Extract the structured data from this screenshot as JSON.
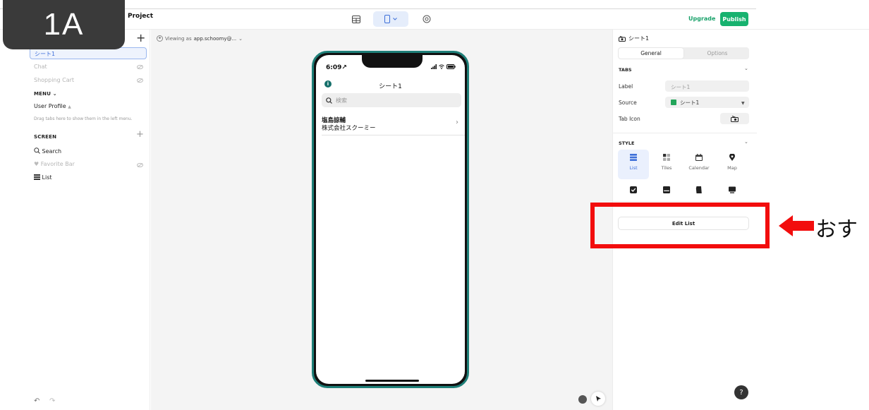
{
  "badge": {
    "label": "1A"
  },
  "header": {
    "project_title": "Project",
    "upgrade_label": "Upgrade",
    "publish_label": "Publish"
  },
  "sidebar": {
    "tabs": [
      {
        "label": "シート1",
        "active": true
      },
      {
        "label": "Chat",
        "hidden": true
      },
      {
        "label": "Shopping Cart",
        "hidden": true
      }
    ],
    "menu_section": "MENU",
    "menu_items": [
      {
        "label": "User Profile"
      }
    ],
    "menu_hint": "Drag tabs here to show them in the left menu.",
    "screen_section": "SCREEN",
    "screen_items": [
      {
        "label": "Search",
        "icon": "search-icon"
      },
      {
        "label": "Favorite Bar",
        "icon": "heart-icon",
        "hidden": true
      },
      {
        "label": "List",
        "icon": "list-icon"
      }
    ]
  },
  "canvas": {
    "viewing_prefix": "Viewing as",
    "viewing_user": "app.schoomy@...",
    "phone": {
      "time": "6:09",
      "title": "シート1",
      "search_placeholder": "検索",
      "rows": [
        {
          "title": "塩島諒輔",
          "subtitle": "株式会社スクーミー"
        }
      ]
    }
  },
  "panel": {
    "title": "シート1",
    "segments": {
      "general": "General",
      "options": "Options"
    },
    "tabs_section": "TABS",
    "label_label": "Label",
    "label_placeholder": "シート1",
    "source_label": "Source",
    "source_value": "シート1",
    "tab_icon_label": "Tab Icon",
    "style_section": "STYLE",
    "styles": [
      {
        "label": "List",
        "selected": true
      },
      {
        "label": "Tiles"
      },
      {
        "label": "Calendar"
      },
      {
        "label": "Map"
      }
    ],
    "edit_list_label": "Edit List"
  },
  "annotation": {
    "label": "おす",
    "color": "#f20d0d"
  },
  "colors": {
    "accent": "#3d6fd9",
    "publish": "#17b26f",
    "phone_frame": "#1e7f78"
  }
}
